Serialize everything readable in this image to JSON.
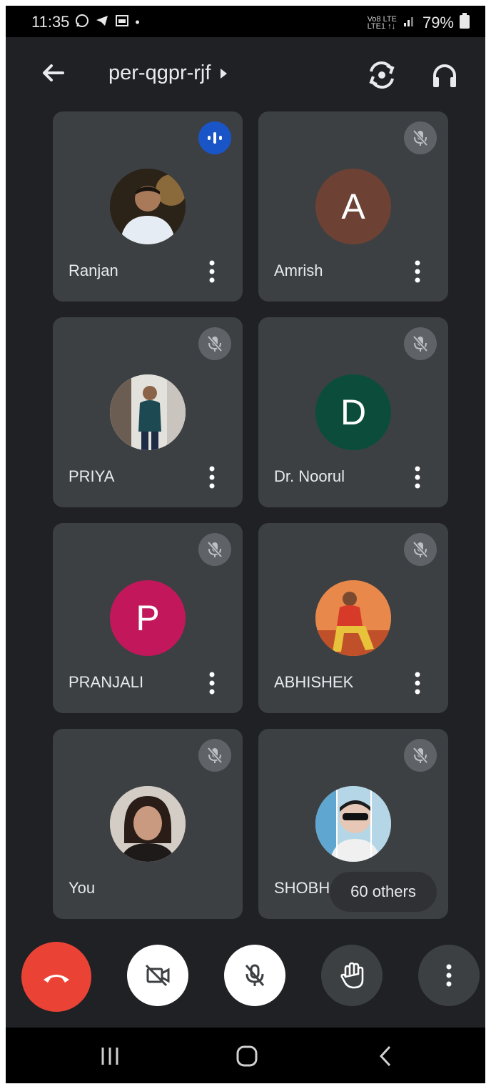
{
  "status_bar": {
    "time": "11:35",
    "network_top": "Vo8 LTE",
    "network_bottom": "LTE1 ↑↓",
    "battery": "79%"
  },
  "header": {
    "meeting_code": "per-qgpr-rjf"
  },
  "participants": [
    {
      "name": "Ranjan",
      "avatar_type": "photo",
      "status": "speaking"
    },
    {
      "name": "Amrish",
      "avatar_type": "letter",
      "initial": "A",
      "color": "#6d4134",
      "status": "muted"
    },
    {
      "name": "PRIYA",
      "avatar_type": "photo",
      "status": "muted"
    },
    {
      "name": "Dr. Noorul",
      "avatar_type": "letter",
      "initial": "D",
      "color": "#0b4d3a",
      "status": "muted"
    },
    {
      "name": "PRANJALI",
      "avatar_type": "letter",
      "initial": "P",
      "color": "#c2185b",
      "status": "muted"
    },
    {
      "name": "ABHISHEK",
      "avatar_type": "photo",
      "status": "muted"
    },
    {
      "name": "You",
      "avatar_type": "photo",
      "status": "muted"
    },
    {
      "name": "SHOBH",
      "avatar_type": "photo",
      "status": "muted",
      "others_label": "60 others"
    }
  ],
  "colors": {
    "background": "#202124",
    "tile": "#3c4043",
    "end_call": "#ea4335",
    "speaking": "#1a55c8"
  },
  "controls": [
    "end-call",
    "camera-off",
    "mic-off",
    "raise-hand",
    "more-options"
  ]
}
